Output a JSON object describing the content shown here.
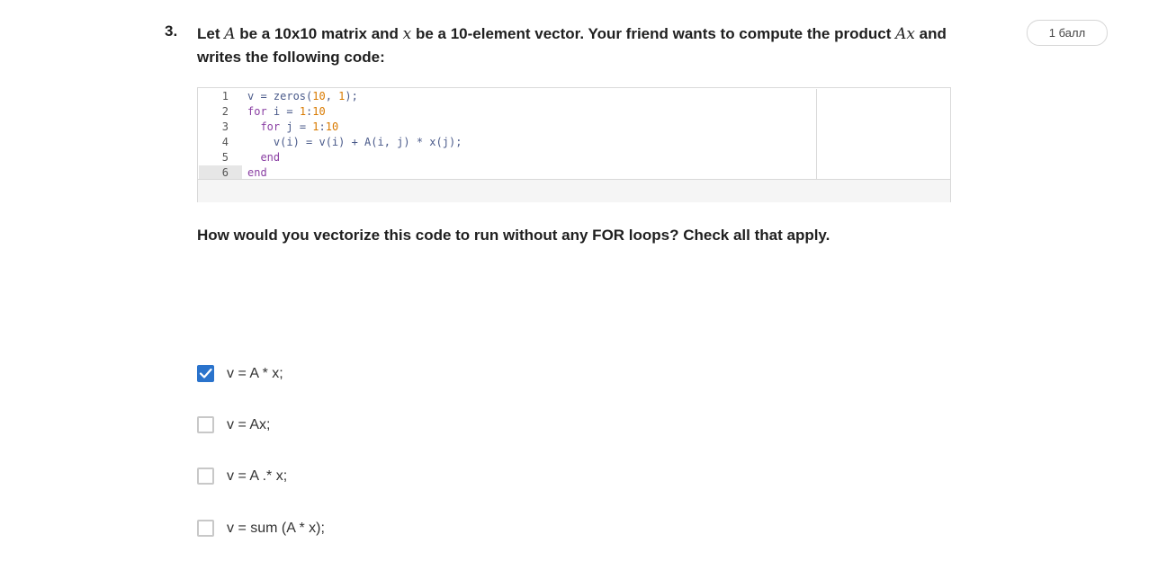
{
  "question": {
    "number": "3.",
    "prompt_parts": [
      "Let ",
      "A",
      " be a 10x10 matrix and ",
      "x",
      " be a 10-element vector. Your friend wants to compute the product ",
      "Ax",
      " and writes the following code:"
    ],
    "points": "1 балл",
    "sub_question": "How would you vectorize this code to run without any FOR loops? Check all that apply."
  },
  "code": {
    "line_numbers": [
      "1",
      "2",
      "3",
      "4",
      "5",
      "6"
    ],
    "active_line": 6,
    "lines": [
      "v = zeros(10, 1);",
      "for i = 1:10",
      "  for j = 1:10",
      "    v(i) = v(i) + A(i, j) * x(j);",
      "  end",
      "end"
    ]
  },
  "options": [
    {
      "label": "v = A * x;",
      "checked": true
    },
    {
      "label": "v = Ax;",
      "checked": false
    },
    {
      "label": "v = A .* x;",
      "checked": false
    },
    {
      "label": "v = sum (A * x);",
      "checked": false
    }
  ],
  "colors": {
    "accent": "#2a73cc",
    "keyword": "#8a3fa3",
    "number": "#d97a00"
  },
  "icons": {
    "check": "check-icon"
  }
}
